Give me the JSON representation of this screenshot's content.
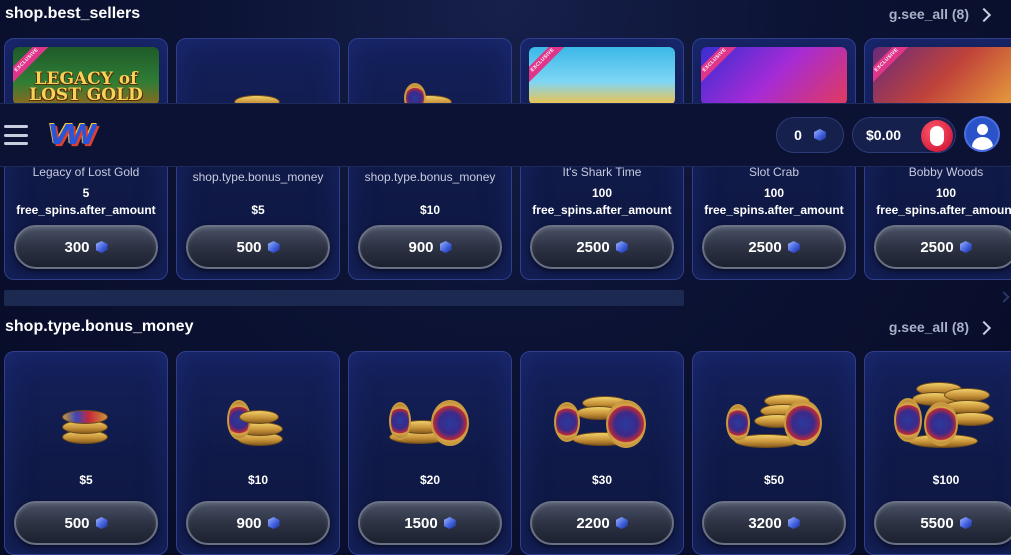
{
  "best_sellers": {
    "title": "shop.best_sellers",
    "see_all": "g.see_all (8)",
    "cards": [
      {
        "thumb_text": "LEGACY of LOST GOLD",
        "ribbon": "EXCLUSIVE",
        "name": "Legacy of Lost Gold",
        "amount": "5",
        "unit": "free_spins.after_amount",
        "price": "300"
      },
      {
        "name": "shop.type.bonus_money",
        "value": "$5",
        "price": "500"
      },
      {
        "name": "shop.type.bonus_money",
        "value": "$10",
        "price": "900"
      },
      {
        "ribbon": "EXCLUSIVE",
        "name": "It's Shark Time",
        "amount": "100",
        "unit": "free_spins.after_amount",
        "price": "2500"
      },
      {
        "ribbon": "EXCLUSIVE",
        "name": "Slot Crab",
        "amount": "100",
        "unit": "free_spins.after_amount",
        "price": "2500"
      },
      {
        "ribbon": "EXCLUSIVE",
        "name": "Bobby Woods",
        "amount": "100",
        "unit": "free_spins.after_amount",
        "price": "2500"
      }
    ]
  },
  "bonus_money": {
    "title": "shop.type.bonus_money",
    "see_all": "g.see_all (8)",
    "cards": [
      {
        "value": "$5",
        "price": "500"
      },
      {
        "value": "$10",
        "price": "900"
      },
      {
        "value": "$20",
        "price": "1500"
      },
      {
        "value": "$30",
        "price": "2200"
      },
      {
        "value": "$50",
        "price": "3200"
      },
      {
        "value": "$100",
        "price": "5500"
      }
    ]
  },
  "header": {
    "gem_balance": "0",
    "cash_balance": "$0.00"
  },
  "icons": {
    "menu": "hamburger-menu-icon",
    "logo": "vw-logo",
    "gem": "gem-icon",
    "cash": "chips-icon",
    "user": "user-icon",
    "chevron": "chevron-right-icon"
  }
}
